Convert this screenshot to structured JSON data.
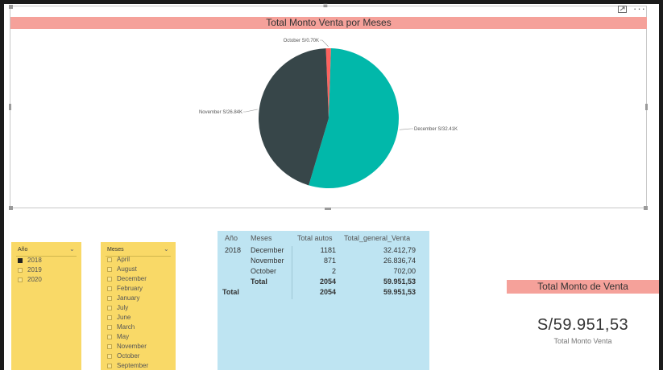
{
  "chart": {
    "title": "Total Monto Venta por Meses",
    "colors": {
      "December": "#01b8aa",
      "November": "#374649",
      "October": "#fd625e"
    }
  },
  "chart_data": {
    "type": "pie",
    "title": "Total Monto Venta por Meses",
    "categories": [
      "December",
      "November",
      "October"
    ],
    "values": [
      32412.79,
      26836.74,
      702.0
    ],
    "labels": [
      "December S/32.41K",
      "November S/26.84K",
      "October S/0.70K"
    ]
  },
  "slicer_year": {
    "header": "Año",
    "items": [
      {
        "label": "2018",
        "checked": true
      },
      {
        "label": "2019",
        "checked": false
      },
      {
        "label": "2020",
        "checked": false
      }
    ]
  },
  "slicer_month": {
    "header": "Meses",
    "items": [
      "April",
      "August",
      "December",
      "February",
      "January",
      "July",
      "June",
      "March",
      "May",
      "November",
      "October",
      "September"
    ]
  },
  "table": {
    "headers": [
      "Año",
      "Meses",
      "Total autos",
      "Total_general_Venta"
    ],
    "year": "2018",
    "rows": [
      {
        "month": "December",
        "autos": "1181",
        "venta": "32.412,79"
      },
      {
        "month": "November",
        "autos": "871",
        "venta": "26.836,74"
      },
      {
        "month": "October",
        "autos": "2",
        "venta": "702,00"
      }
    ],
    "subtotal": {
      "label": "Total",
      "autos": "2054",
      "venta": "59.951,53"
    },
    "grand_total": {
      "label": "Total",
      "autos": "2054",
      "venta": "59.951,53"
    }
  },
  "card": {
    "title": "Total Monto de Venta",
    "value": "S/59.951,53",
    "caption": "Total Monto Venta"
  },
  "icons": {
    "grip": "grip-icon",
    "focus": "focus-mode-icon",
    "more": "more-options-icon"
  }
}
